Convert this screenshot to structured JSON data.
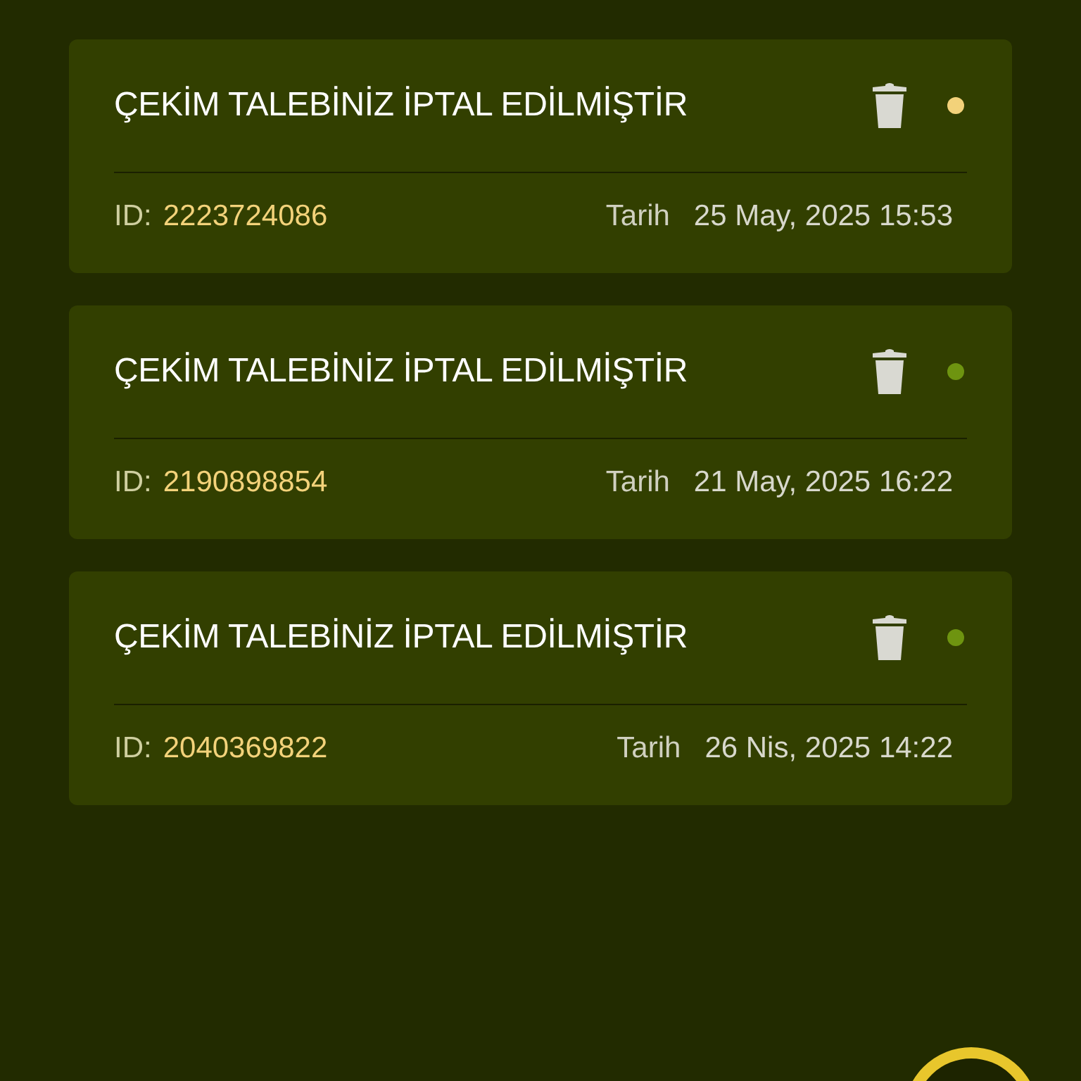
{
  "notifications": [
    {
      "title": "ÇEKİM TALEBİNİZ İPTAL EDİLMİŞTİR",
      "color": "#f3d27a",
      "id_label": "ID:",
      "id": "2223724086",
      "date_label": "Tarih",
      "date": "25 May, 2025 15:53"
    },
    {
      "title": "ÇEKİM TALEBİNİZ İPTAL EDİLMİŞTİR",
      "color": "#6e9410",
      "id_label": "ID:",
      "id": "2190898854",
      "date_label": "Tarih",
      "date": "21 May, 2025 16:22"
    },
    {
      "title": "ÇEKİM TALEBİNİZ İPTAL EDİLMİŞTİR",
      "color": "#6e9410",
      "id_label": "ID:",
      "id": "2040369822",
      "date_label": "Tarih",
      "date": "26 Nis, 2025 14:22"
    }
  ]
}
